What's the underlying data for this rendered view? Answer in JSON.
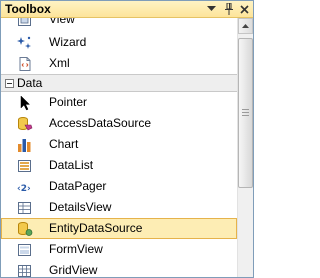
{
  "window": {
    "title": "Toolbox",
    "buttons": [
      "dropdown-icon",
      "pin-icon",
      "close-icon"
    ]
  },
  "items_top": [
    {
      "label": "View",
      "icon": "view-icon"
    },
    {
      "label": "Wizard",
      "icon": "wizard-icon"
    },
    {
      "label": "Xml",
      "icon": "xml-icon"
    }
  ],
  "category": {
    "label": "Data",
    "state": "expanded"
  },
  "items_data": [
    {
      "label": "Pointer",
      "icon": "pointer-icon"
    },
    {
      "label": "AccessDataSource",
      "icon": "access-datasource-icon"
    },
    {
      "label": "Chart",
      "icon": "chart-icon"
    },
    {
      "label": "DataList",
      "icon": "datalist-icon"
    },
    {
      "label": "DataPager",
      "icon": "datapager-icon"
    },
    {
      "label": "DetailsView",
      "icon": "detailsview-icon"
    },
    {
      "label": "EntityDataSource",
      "icon": "entity-datasource-icon",
      "selected": true
    },
    {
      "label": "FormView",
      "icon": "formview-icon"
    },
    {
      "label": "GridView",
      "icon": "gridview-icon"
    }
  ],
  "colors": {
    "title_bg": "#fde49a",
    "selected_bg": "#fdedb4",
    "selected_border": "#e6b34b",
    "category_bg": "#eeeeee"
  }
}
